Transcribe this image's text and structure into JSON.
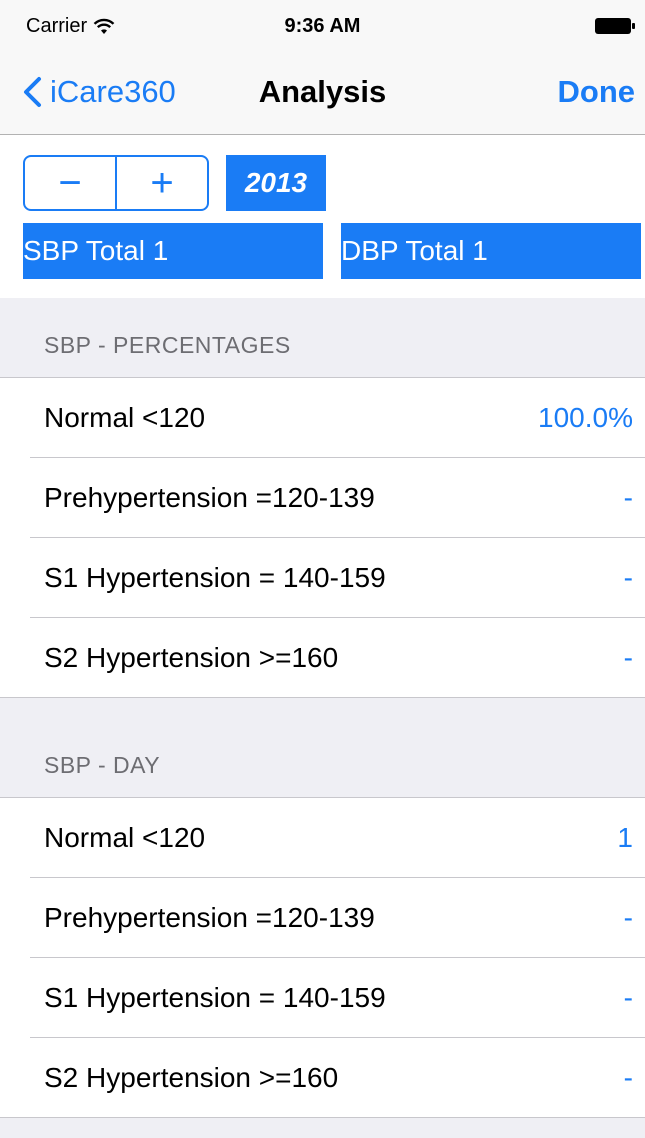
{
  "status_bar": {
    "carrier": "Carrier",
    "time": "9:36 AM",
    "icons": [
      "wifi-icon",
      "battery-icon"
    ]
  },
  "nav": {
    "back_label": "iCare360",
    "title": "Analysis",
    "done_label": "Done",
    "icons": [
      "chevron-left-icon"
    ]
  },
  "controls": {
    "stepper_minus": "−",
    "stepper_plus": "+",
    "year": "2013",
    "sbp_total": "SBP Total 1",
    "dbp_total": "DBP Total 1"
  },
  "sections": [
    {
      "header": "SBP - PERCENTAGES",
      "rows": [
        {
          "label": "Normal <120",
          "value": "100.0%"
        },
        {
          "label": "Prehypertension =120-139",
          "value": "-"
        },
        {
          "label": "S1 Hypertension = 140-159",
          "value": "-"
        },
        {
          "label": "S2 Hypertension >=160",
          "value": "-"
        }
      ]
    },
    {
      "header": "SBP - DAY",
      "rows": [
        {
          "label": "Normal <120",
          "value": "1"
        },
        {
          "label": "Prehypertension =120-139",
          "value": "-"
        },
        {
          "label": "S1 Hypertension = 140-159",
          "value": "-"
        },
        {
          "label": "S2 Hypertension >=160",
          "value": "-"
        }
      ]
    }
  ],
  "colors": {
    "accent": "#1a7cf5",
    "grouped_background": "#efeff4",
    "header_text": "#6d6d72",
    "separator": "#c8c7cc"
  }
}
